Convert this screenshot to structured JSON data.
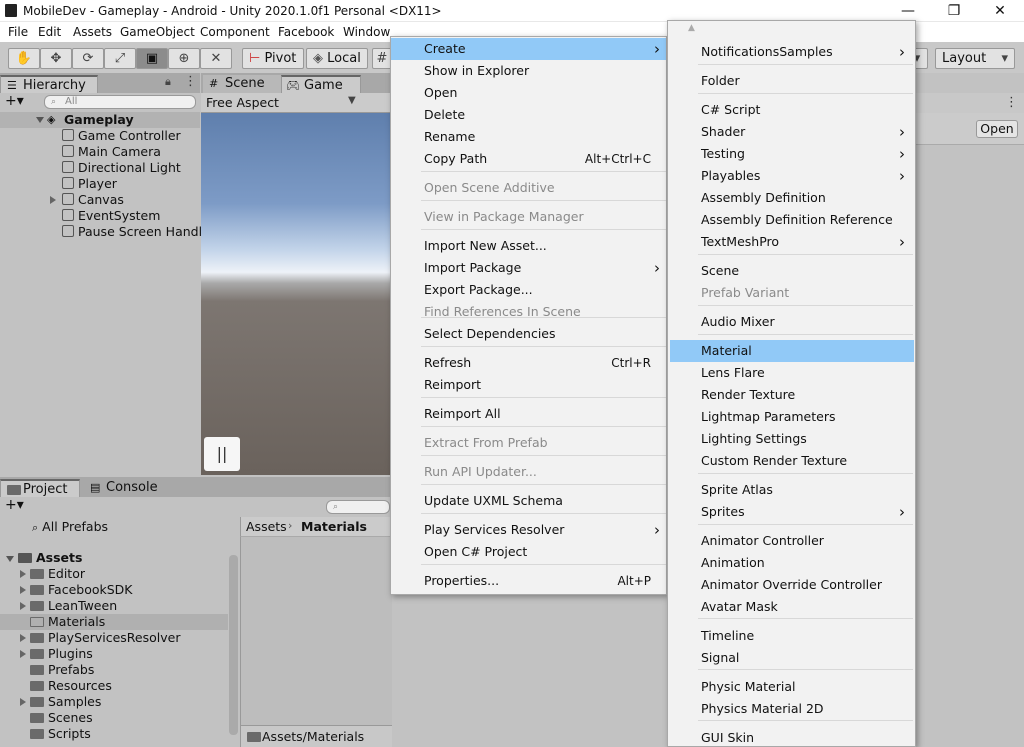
{
  "window": {
    "title": "MobileDev - Gameplay - Android - Unity 2020.1.0f1 Personal <DX11>",
    "controls": {
      "minimize": "—",
      "maximize": "❐",
      "close": "✕"
    }
  },
  "menubar": [
    "File",
    "Edit",
    "Assets",
    "GameObject",
    "Component",
    "Facebook",
    "Window"
  ],
  "toolbar": {
    "pivot_label": "Pivot",
    "local_label": "Local",
    "layout_label": "Layout"
  },
  "hierarchy": {
    "tab_label": "Hierarchy",
    "search_placeholder": "All",
    "scene_name": "Gameplay",
    "items": [
      "Game Controller",
      "Main Camera",
      "Directional Light",
      "Player",
      "Canvas",
      "EventSystem",
      "Pause Screen Handle"
    ]
  },
  "scene_tabs": {
    "scene_label": "Scene",
    "game_label": "Game",
    "aspect_label": "Free Aspect",
    "pause_glyph": "||"
  },
  "inspector": {
    "open_button": "Open"
  },
  "project": {
    "tab_label": "Project",
    "console_label": "Console",
    "all_prefabs": "All Prefabs",
    "assets_root": "Assets",
    "folders": [
      "Editor",
      "FacebookSDK",
      "LeanTween",
      "Materials",
      "PlayServicesResolver",
      "Plugins",
      "Prefabs",
      "Resources",
      "Samples",
      "Scenes",
      "Scripts"
    ],
    "breadcrumb_root": "Assets",
    "breadcrumb_current": "Materials",
    "footer_path": "Assets/Materials"
  },
  "context_menu": {
    "items": [
      {
        "label": "Create",
        "shortcut": "",
        "submenu": true,
        "disabled": false,
        "highlight": true
      },
      {
        "label": "Show in Explorer",
        "shortcut": "",
        "submenu": false,
        "disabled": false
      },
      {
        "label": "Open",
        "shortcut": "",
        "submenu": false,
        "disabled": false
      },
      {
        "label": "Delete",
        "shortcut": "",
        "submenu": false,
        "disabled": false
      },
      {
        "label": "Rename",
        "shortcut": "",
        "submenu": false,
        "disabled": false
      },
      {
        "label": "Copy Path",
        "shortcut": "Alt+Ctrl+C",
        "submenu": false,
        "disabled": false
      },
      {
        "label": "Open Scene Additive",
        "shortcut": "",
        "submenu": false,
        "disabled": true
      },
      {
        "label": "View in Package Manager",
        "shortcut": "",
        "submenu": false,
        "disabled": true
      },
      {
        "label": "Import New Asset...",
        "shortcut": "",
        "submenu": false,
        "disabled": false
      },
      {
        "label": "Import Package",
        "shortcut": "",
        "submenu": true,
        "disabled": false
      },
      {
        "label": "Export Package...",
        "shortcut": "",
        "submenu": false,
        "disabled": false
      },
      {
        "label": "Find References In Scene",
        "shortcut": "",
        "submenu": false,
        "disabled": true
      },
      {
        "label": "Select Dependencies",
        "shortcut": "",
        "submenu": false,
        "disabled": false
      },
      {
        "label": "Refresh",
        "shortcut": "Ctrl+R",
        "submenu": false,
        "disabled": false
      },
      {
        "label": "Reimport",
        "shortcut": "",
        "submenu": false,
        "disabled": false
      },
      {
        "label": "Reimport All",
        "shortcut": "",
        "submenu": false,
        "disabled": false
      },
      {
        "label": "Extract From Prefab",
        "shortcut": "",
        "submenu": false,
        "disabled": true
      },
      {
        "label": "Run API Updater...",
        "shortcut": "",
        "submenu": false,
        "disabled": true
      },
      {
        "label": "Update UXML Schema",
        "shortcut": "",
        "submenu": false,
        "disabled": false
      },
      {
        "label": "Play Services Resolver",
        "shortcut": "",
        "submenu": true,
        "disabled": false
      },
      {
        "label": "Open C# Project",
        "shortcut": "",
        "submenu": false,
        "disabled": false
      },
      {
        "label": "Properties...",
        "shortcut": "Alt+P",
        "submenu": false,
        "disabled": false
      }
    ]
  },
  "create_submenu": {
    "items": [
      {
        "label": "NotificationsSamples",
        "submenu": true,
        "disabled": false
      },
      {
        "label": "Folder",
        "submenu": false,
        "disabled": false
      },
      {
        "label": "C# Script",
        "submenu": false,
        "disabled": false
      },
      {
        "label": "Shader",
        "submenu": true,
        "disabled": false
      },
      {
        "label": "Testing",
        "submenu": true,
        "disabled": false
      },
      {
        "label": "Playables",
        "submenu": true,
        "disabled": false
      },
      {
        "label": "Assembly Definition",
        "submenu": false,
        "disabled": false
      },
      {
        "label": "Assembly Definition Reference",
        "submenu": false,
        "disabled": false
      },
      {
        "label": "TextMeshPro",
        "submenu": true,
        "disabled": false
      },
      {
        "label": "Scene",
        "submenu": false,
        "disabled": false
      },
      {
        "label": "Prefab Variant",
        "submenu": false,
        "disabled": true
      },
      {
        "label": "Audio Mixer",
        "submenu": false,
        "disabled": false
      },
      {
        "label": "Material",
        "submenu": false,
        "disabled": false,
        "highlight": true
      },
      {
        "label": "Lens Flare",
        "submenu": false,
        "disabled": false
      },
      {
        "label": "Render Texture",
        "submenu": false,
        "disabled": false
      },
      {
        "label": "Lightmap Parameters",
        "submenu": false,
        "disabled": false
      },
      {
        "label": "Lighting Settings",
        "submenu": false,
        "disabled": false
      },
      {
        "label": "Custom Render Texture",
        "submenu": false,
        "disabled": false
      },
      {
        "label": "Sprite Atlas",
        "submenu": false,
        "disabled": false
      },
      {
        "label": "Sprites",
        "submenu": true,
        "disabled": false
      },
      {
        "label": "Animator Controller",
        "submenu": false,
        "disabled": false
      },
      {
        "label": "Animation",
        "submenu": false,
        "disabled": false
      },
      {
        "label": "Animator Override Controller",
        "submenu": false,
        "disabled": false
      },
      {
        "label": "Avatar Mask",
        "submenu": false,
        "disabled": false
      },
      {
        "label": "Timeline",
        "submenu": false,
        "disabled": false
      },
      {
        "label": "Signal",
        "submenu": false,
        "disabled": false
      },
      {
        "label": "Physic Material",
        "submenu": false,
        "disabled": false
      },
      {
        "label": "Physics Material 2D",
        "submenu": false,
        "disabled": false
      },
      {
        "label": "GUI Skin",
        "submenu": false,
        "disabled": false
      }
    ]
  }
}
